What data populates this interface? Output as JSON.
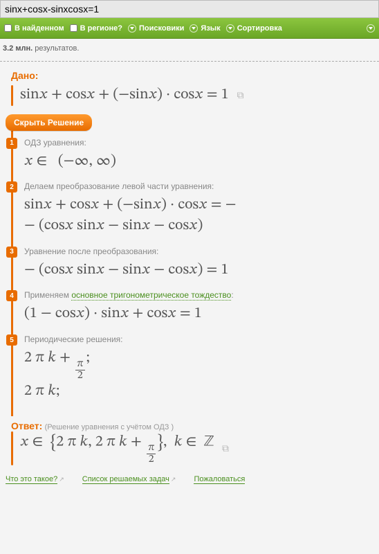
{
  "search": {
    "value": "sinx+cosx-sinxcosx=1"
  },
  "filters": {
    "found_label": "В найденном",
    "region_label": "В регионе?",
    "engines_label": "Поисковики",
    "lang_label": "Язык",
    "sort_label": "Сортировка"
  },
  "results": {
    "count": "3.2 млн.",
    "suffix": "результатов."
  },
  "given": {
    "label": "Дано:",
    "expr": "sin𝑥 + cos𝑥 + (−sin𝑥) · cos𝑥 = 1"
  },
  "hide_button": "Скрыть Решение",
  "steps": [
    {
      "num": "1",
      "label": "ОДЗ уравнения:",
      "link": "",
      "math_html": "𝑥 ∈&nbsp;&nbsp; (−∞, ∞)"
    },
    {
      "num": "2",
      "label": "Делаем преобразование левой части уравнения:",
      "link": "",
      "math_html": "sin𝑥 + cos𝑥 + (−sin𝑥) · cos𝑥 = −<br>− (cos𝑥 sin𝑥 − sin𝑥 − cos𝑥)"
    },
    {
      "num": "3",
      "label": "Уравнение после преобразования:",
      "link": "",
      "math_html": "− (cos𝑥 sin𝑥 − sin𝑥 − cos𝑥) = 1"
    },
    {
      "num": "4",
      "label": "Применяем ",
      "link": "основное тригонометрическое тождество",
      "label_after": ":",
      "math_html": "(1 − cos𝑥) · sin𝑥 + cos𝑥 = 1"
    },
    {
      "num": "5",
      "label": "Периодические решения:",
      "link": "",
      "math_html": "2 π 𝑘 + <span class='frac'><span class='top'>π</span><span class='bot'>2</span></span>;<br>2 π 𝑘;"
    }
  ],
  "answer": {
    "label": "Ответ:",
    "note": "(Решение уравнения с учётом ОДЗ )",
    "math_html": "𝑥 ∈&nbsp;&nbsp;<span class='curly-l'>{</span>2 π 𝑘, 2 π 𝑘 + <span class='frac'><span class='top'>π</span><span class='bot'>2</span></span><span class='curly-r'>}</span>,&nbsp;&nbsp;𝑘 ∈&nbsp;&nbsp;ℤ"
  },
  "footer": {
    "what": "Что это такое?",
    "tasks": "Список решаемых задач",
    "complain": "Пожаловаться"
  }
}
